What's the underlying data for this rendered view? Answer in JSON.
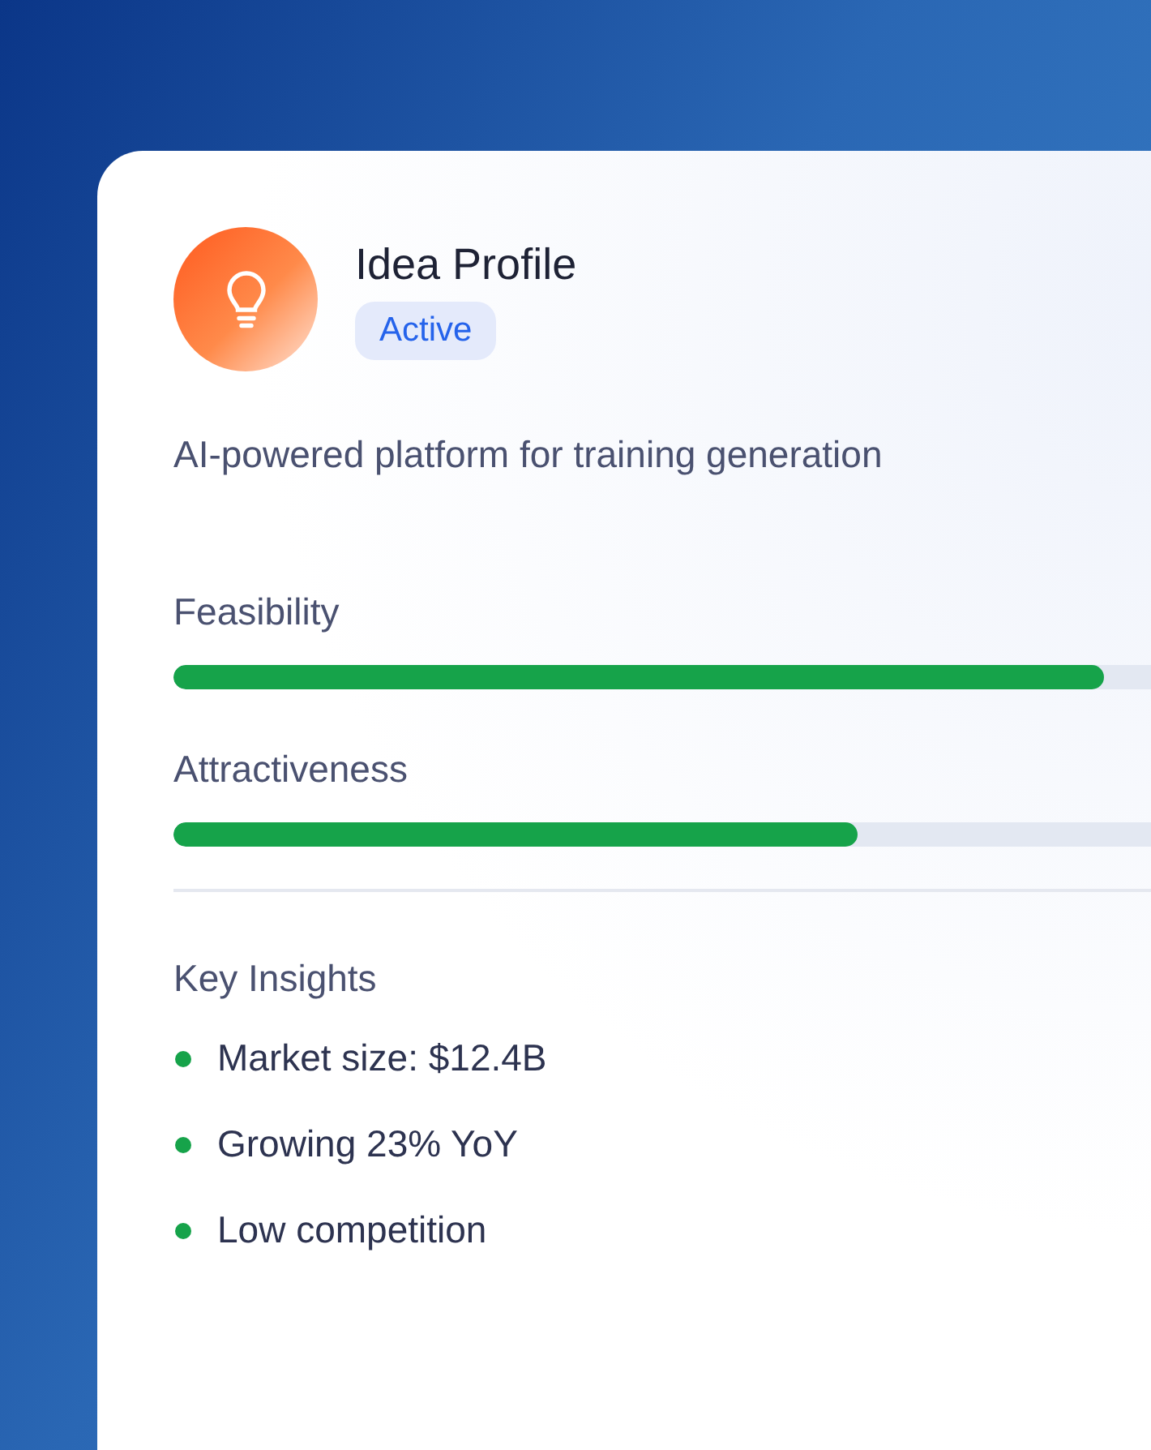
{
  "profile": {
    "title": "Idea Profile",
    "status": "Active",
    "description": "AI-powered platform for training generation"
  },
  "metrics": [
    {
      "label": "Feasibility",
      "level": 0.87
    },
    {
      "label": "Attractiveness",
      "level": 0.64
    }
  ],
  "insights": {
    "title": "Key Insights",
    "items": [
      {
        "text": "Market size: $12.4B",
        "color": "#16a34a"
      },
      {
        "text": "Growing 23% YoY",
        "color": "#16a34a"
      },
      {
        "text": "Low competition",
        "color": "#16a34a"
      }
    ]
  }
}
